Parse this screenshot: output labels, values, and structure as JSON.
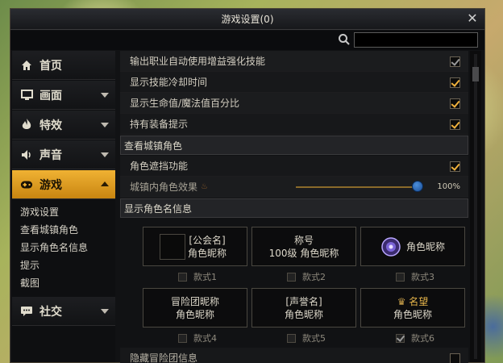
{
  "window": {
    "title": "游戏设置(0)"
  },
  "search": {
    "placeholder": ""
  },
  "sidebar": {
    "items": [
      {
        "label": "首页",
        "icon": "home-icon"
      },
      {
        "label": "画面",
        "icon": "monitor-icon"
      },
      {
        "label": "特效",
        "icon": "flame-icon"
      },
      {
        "label": "声音",
        "icon": "speaker-icon"
      },
      {
        "label": "游戏",
        "icon": "gamepad-icon"
      },
      {
        "label": "社交",
        "icon": "chat-icon"
      }
    ],
    "subitems": [
      "游戏设置",
      "查看城镇角色",
      "显示角色名信息",
      "提示",
      "截图"
    ]
  },
  "settings": {
    "auto_skill": "输出职业自动使用增益强化技能",
    "show_cooldown": "显示技能冷却时间",
    "show_hp_mp": "显示生命值/魔法值百分比",
    "equip_tip": "持有装备提示",
    "section_town": "查看城镇角色",
    "char_block": "角色遮挡功能",
    "town_effect": "城镇内角色效果",
    "town_effect_value": "100%",
    "section_name": "显示角色名信息",
    "hide_guild": "隐藏冒险团信息"
  },
  "checks": {
    "auto_skill": true,
    "show_cooldown": true,
    "show_hp_mp": true,
    "equip_tip": true,
    "char_block": true,
    "hide_guild": false
  },
  "slider": {
    "town_effect_fraction": 1.0
  },
  "name_styles": [
    {
      "line1": "[公会名]",
      "line2": "角色昵称",
      "option": "款式1",
      "checked": false
    },
    {
      "line1": "称号",
      "line2": "100级 角色昵称",
      "option": "款式2",
      "checked": false
    },
    {
      "line1": "",
      "line2": "角色昵称",
      "option": "款式3",
      "checked": false
    },
    {
      "line1": "冒险团昵称",
      "line2": "角色昵称",
      "option": "款式4",
      "checked": false
    },
    {
      "line1": "[声誉名]",
      "line2": "角色昵称",
      "option": "款式5",
      "checked": false
    },
    {
      "line1": "名望",
      "line2": "角色昵称",
      "option": "款式6",
      "checked": true
    }
  ],
  "colors": {
    "accent": "#f0b233",
    "check": "#f2b23c",
    "slider_knob": "#2d6bbd"
  }
}
